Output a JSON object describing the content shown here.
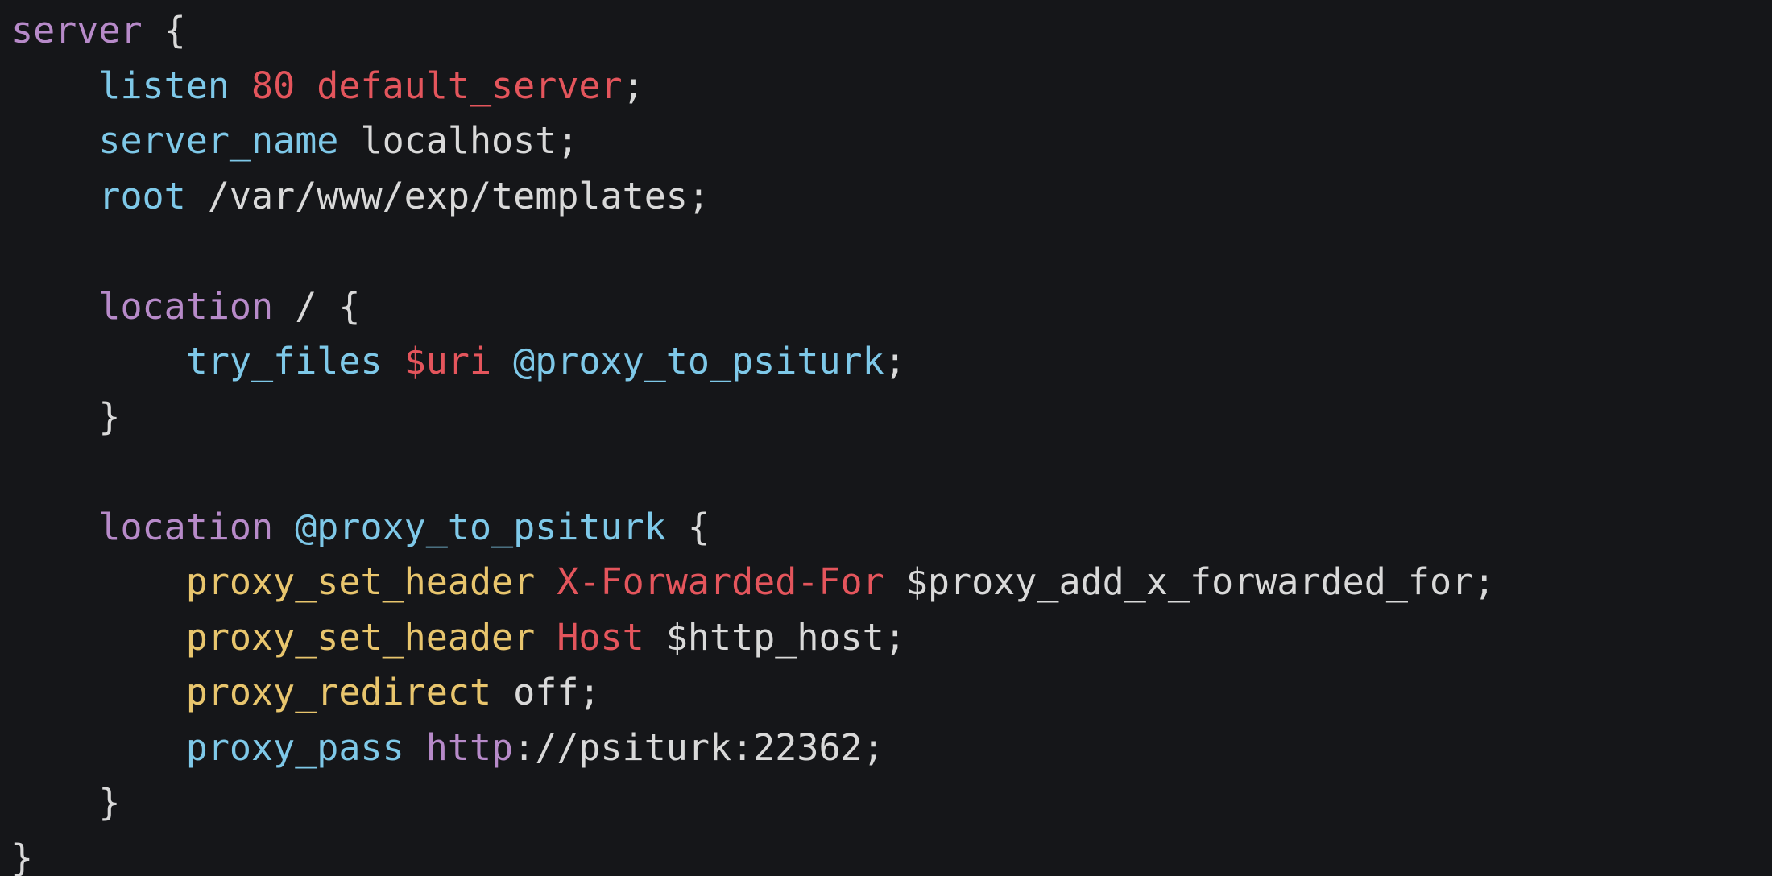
{
  "colors": {
    "background": "#151619",
    "keyword": "#b78ac9",
    "directive": "#7ec8e8",
    "value": "#e4555c",
    "header_directive": "#e8c56d",
    "plain": "#d9d9d9"
  },
  "code": {
    "lines": [
      [
        {
          "t": "server",
          "c": "keyword"
        },
        {
          "t": " {",
          "c": "plain"
        }
      ],
      [
        {
          "t": "    ",
          "c": "plain"
        },
        {
          "t": "listen",
          "c": "directive"
        },
        {
          "t": " ",
          "c": "plain"
        },
        {
          "t": "80 default_server",
          "c": "red"
        },
        {
          "t": ";",
          "c": "plain"
        }
      ],
      [
        {
          "t": "    ",
          "c": "plain"
        },
        {
          "t": "server_name",
          "c": "directive"
        },
        {
          "t": " localhost;",
          "c": "plain"
        }
      ],
      [
        {
          "t": "    ",
          "c": "plain"
        },
        {
          "t": "root",
          "c": "directive"
        },
        {
          "t": " /var/www/exp/templates;",
          "c": "plain"
        }
      ],
      [],
      [
        {
          "t": "    ",
          "c": "plain"
        },
        {
          "t": "location",
          "c": "keyword"
        },
        {
          "t": " / {",
          "c": "plain"
        }
      ],
      [
        {
          "t": "        ",
          "c": "plain"
        },
        {
          "t": "try_files",
          "c": "directive"
        },
        {
          "t": " ",
          "c": "plain"
        },
        {
          "t": "$uri",
          "c": "red"
        },
        {
          "t": " ",
          "c": "plain"
        },
        {
          "t": "@proxy_to_psiturk",
          "c": "directive"
        },
        {
          "t": ";",
          "c": "plain"
        }
      ],
      [
        {
          "t": "    }",
          "c": "plain"
        }
      ],
      [],
      [
        {
          "t": "    ",
          "c": "plain"
        },
        {
          "t": "location",
          "c": "keyword"
        },
        {
          "t": " ",
          "c": "plain"
        },
        {
          "t": "@proxy_to_psiturk",
          "c": "directive"
        },
        {
          "t": " {",
          "c": "plain"
        }
      ],
      [
        {
          "t": "        ",
          "c": "plain"
        },
        {
          "t": "proxy_set_header",
          "c": "yellow"
        },
        {
          "t": " ",
          "c": "plain"
        },
        {
          "t": "X-Forwarded-For",
          "c": "red"
        },
        {
          "t": " $proxy_add_x_forwarded_for;",
          "c": "plain"
        }
      ],
      [
        {
          "t": "        ",
          "c": "plain"
        },
        {
          "t": "proxy_set_header",
          "c": "yellow"
        },
        {
          "t": " ",
          "c": "plain"
        },
        {
          "t": "Host",
          "c": "red"
        },
        {
          "t": " $http_host;",
          "c": "plain"
        }
      ],
      [
        {
          "t": "        ",
          "c": "plain"
        },
        {
          "t": "proxy_redirect",
          "c": "yellow"
        },
        {
          "t": " off;",
          "c": "plain"
        }
      ],
      [
        {
          "t": "        ",
          "c": "plain"
        },
        {
          "t": "proxy_pass",
          "c": "directive"
        },
        {
          "t": " ",
          "c": "plain"
        },
        {
          "t": "http",
          "c": "keyword"
        },
        {
          "t": "://psiturk:22362;",
          "c": "plain"
        }
      ],
      [
        {
          "t": "    }",
          "c": "plain"
        }
      ],
      [
        {
          "t": "}",
          "c": "plain"
        }
      ]
    ]
  }
}
